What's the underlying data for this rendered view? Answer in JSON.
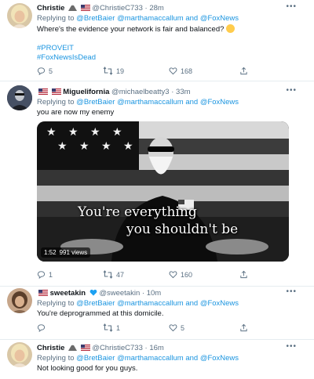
{
  "tweets": [
    {
      "name": "Christie",
      "handle": "@ChristieC733",
      "time": "28m",
      "reply_prefix": "Replying to",
      "mentions": [
        "@BretBaier",
        "@marthamaccallum",
        "and",
        "@FoxNews"
      ],
      "text": "Where's the evidence your network is fair and balanced?",
      "hashtags": [
        "#PROVEIT",
        "#FoxNewsIsDead"
      ],
      "replies": "5",
      "retweets": "19",
      "likes": "168"
    },
    {
      "name": "Miguelifornia",
      "handle": "@michaelbeatty3",
      "time": "33m",
      "reply_prefix": "Replying to",
      "mentions": [
        "@BretBaier",
        "@marthamaccallum",
        "and",
        "@FoxNews"
      ],
      "text": "you are now my enemy",
      "video": {
        "caption_line1": "You're everything",
        "caption_line2": "you shouldn't be",
        "duration": "1:52",
        "views": "991 views"
      },
      "replies": "1",
      "retweets": "47",
      "likes": "160"
    },
    {
      "name": "sweetakin",
      "handle": "@sweetakin",
      "time": "10m",
      "reply_prefix": "Replying to",
      "mentions": [
        "@BretBaier",
        "@marthamaccallum",
        "and",
        "@FoxNews"
      ],
      "text": "You're deprogrammed at this domicile.",
      "replies": "",
      "retweets": "1",
      "likes": "5"
    },
    {
      "name": "Christie",
      "handle": "@ChristieC733",
      "time": "16m",
      "reply_prefix": "Replying to",
      "mentions": [
        "@BretBaier",
        "@marthamaccallum",
        "and",
        "@FoxNews"
      ],
      "text": "Not looking good for you guys."
    }
  ],
  "separator": "·",
  "more_icon": "more-dots-icon",
  "colors": {
    "link": "#1b95e0",
    "muted": "#5b7083",
    "verified": "#1da1f2"
  }
}
